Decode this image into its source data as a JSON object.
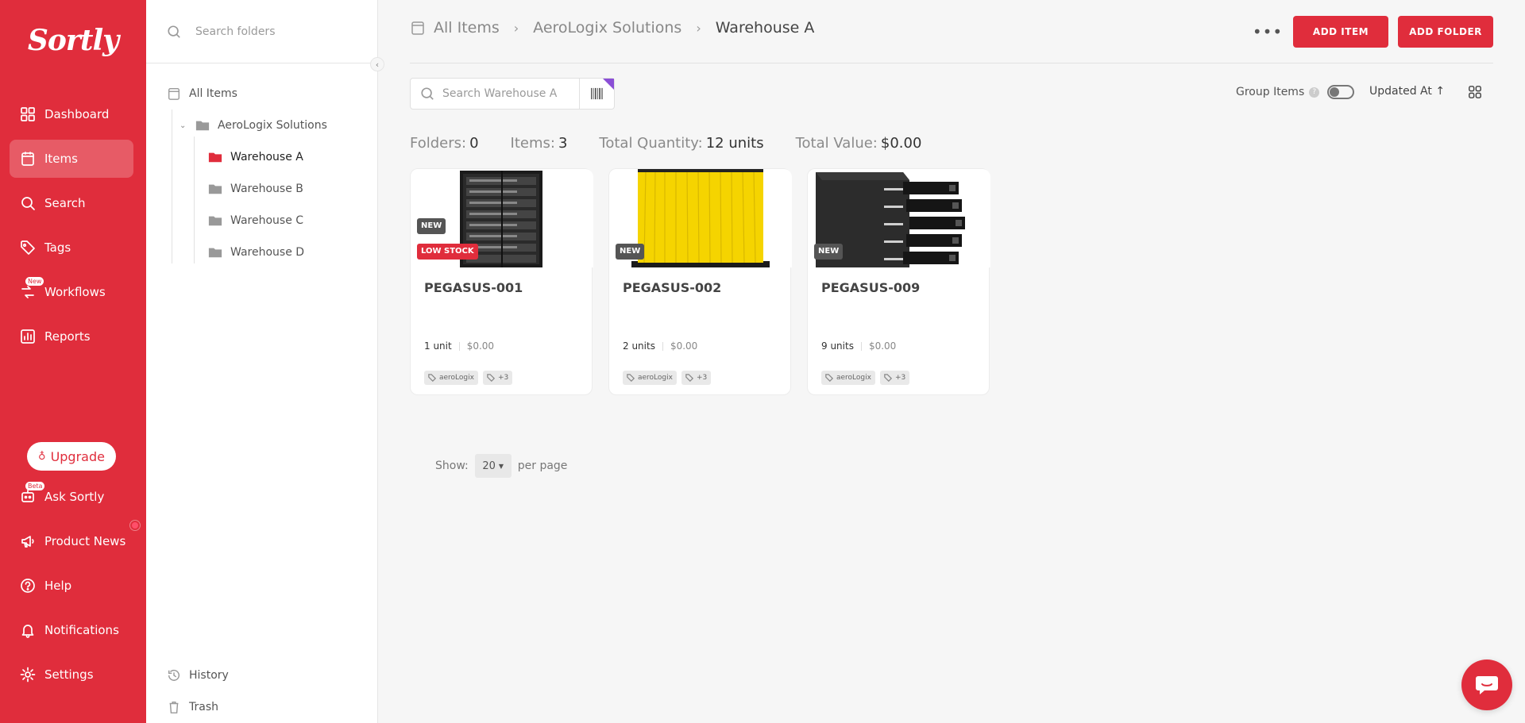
{
  "app": {
    "logo": "Sortly"
  },
  "nav": {
    "items": [
      {
        "label": "Dashboard",
        "icon": "dashboard-icon"
      },
      {
        "label": "Items",
        "icon": "items-icon",
        "active": true
      },
      {
        "label": "Search",
        "icon": "search-icon"
      },
      {
        "label": "Tags",
        "icon": "tag-icon"
      },
      {
        "label": "Workflows",
        "icon": "workflows-icon",
        "badge": "New"
      },
      {
        "label": "Reports",
        "icon": "reports-icon"
      }
    ],
    "upgrade_label": "Upgrade",
    "bottom_items": [
      {
        "label": "Ask Sortly",
        "icon": "ask-sortly-icon",
        "badge": "Beta"
      },
      {
        "label": "Product News",
        "icon": "megaphone-icon"
      },
      {
        "label": "Help",
        "icon": "help-icon"
      },
      {
        "label": "Notifications",
        "icon": "bell-icon"
      },
      {
        "label": "Settings",
        "icon": "gear-icon"
      }
    ]
  },
  "folders": {
    "search_placeholder": "Search folders",
    "tree": {
      "root": "All Items",
      "parent": "AeroLogix Solutions",
      "children": [
        "Warehouse A",
        "Warehouse B",
        "Warehouse C",
        "Warehouse D"
      ],
      "selected": "Warehouse A"
    },
    "history_label": "History",
    "trash_label": "Trash"
  },
  "header": {
    "breadcrumb": [
      "All Items",
      "AeroLogix Solutions",
      "Warehouse A"
    ],
    "more_label": "•••",
    "add_item_label": "ADD ITEM",
    "add_folder_label": "ADD FOLDER"
  },
  "toolbar": {
    "search_placeholder": "Search Warehouse A",
    "group_items_label": "Group Items",
    "group_items_enabled": false,
    "sort_label": "Updated At",
    "sort_direction_icon": "↑"
  },
  "stats": {
    "folders_label": "Folders:",
    "folders_value": "0",
    "items_label": "Items:",
    "items_value": "3",
    "qty_label": "Total Quantity:",
    "qty_value": "12 units",
    "value_label": "Total Value:",
    "value_value": "$0.00"
  },
  "items": [
    {
      "name": "PEGASUS-001",
      "qty": "1 unit",
      "price": "$0.00",
      "badges": [
        "NEW",
        "LOW STOCK"
      ],
      "tag": "aeroLogix",
      "more_tags": "+3",
      "image": "server-rack"
    },
    {
      "name": "PEGASUS-002",
      "qty": "2 units",
      "price": "$0.00",
      "badges": [
        "NEW"
      ],
      "tag": "aeroLogix",
      "more_tags": "+3",
      "image": "yellow-cable-spool"
    },
    {
      "name": "PEGASUS-009",
      "qty": "9 units",
      "price": "$0.00",
      "badges": [
        "NEW"
      ],
      "tag": "aeroLogix",
      "more_tags": "+3",
      "image": "drive-enclosure"
    }
  ],
  "pagination": {
    "show_label": "Show:",
    "per_page_value": "20",
    "per_page_label": "per page"
  },
  "colors": {
    "brand": "#e02d3c",
    "accent_corner": "#8b4fd6"
  }
}
